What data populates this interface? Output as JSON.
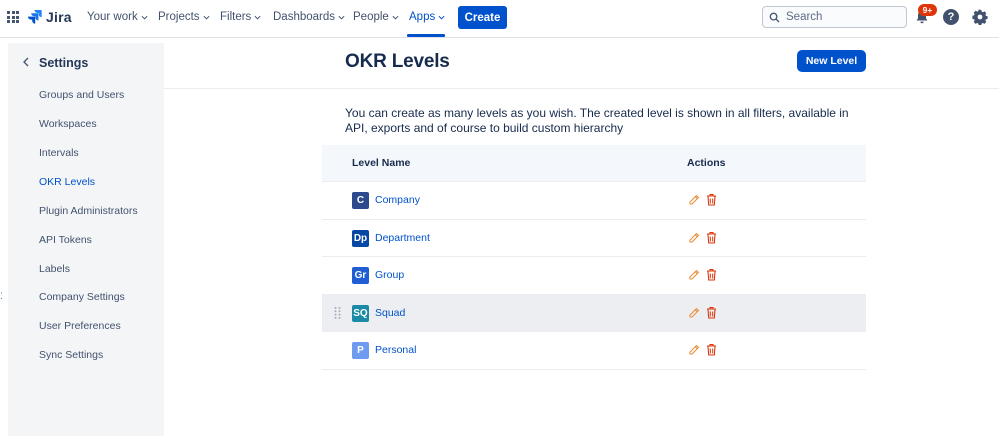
{
  "topbar": {
    "product": "Jira",
    "nav": [
      "Your work",
      "Projects",
      "Filters",
      "Dashboards",
      "People",
      "Apps"
    ],
    "active_nav": "Apps",
    "create_label": "Create",
    "search_placeholder": "Search",
    "notifications_badge": "9+",
    "help_label": "?"
  },
  "sidebar": {
    "title": "Settings",
    "items": [
      "Groups and Users",
      "Workspaces",
      "Intervals",
      "OKR Levels",
      "Plugin Administrators",
      "API Tokens",
      "Labels",
      "Company Settings",
      "User Preferences",
      "Sync Settings"
    ],
    "active": "OKR Levels"
  },
  "main": {
    "title": "OKR Levels",
    "new_level_label": "New Level",
    "description": "You can create as many levels as you wish. The created level is shown in all filters, available in API, exports and of course to build custom hierarchy",
    "table": {
      "headers": [
        "Level Name",
        "Actions"
      ],
      "rows": [
        {
          "abbr": "C",
          "name": "Company",
          "color": "#2d4a8c"
        },
        {
          "abbr": "Dp",
          "name": "Department",
          "color": "#0747a6"
        },
        {
          "abbr": "Gr",
          "name": "Group",
          "color": "#1f5fd3"
        },
        {
          "abbr": "SQ",
          "name": "Squad",
          "color": "#1b8aa6"
        },
        {
          "abbr": "P",
          "name": "Personal",
          "color": "#6e9af0"
        }
      ]
    }
  },
  "colors": {
    "brand": "#0052cc",
    "edit_icon": "#e8913a",
    "delete_icon": "#de350b"
  }
}
